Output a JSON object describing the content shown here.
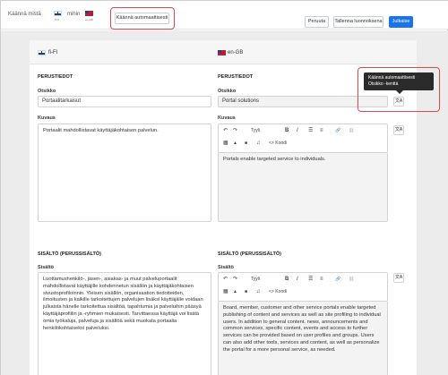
{
  "topbar": {
    "translate_from_label": "Käännä mistä",
    "from_flag_caption": "fi-FI",
    "translate_to_label": "mihin",
    "to_flag_caption": "en-GB",
    "auto_translate_button": "Käännä automaattisesti",
    "cancel_button": "Peruuta",
    "save_draft_button": "Tallenna luonnoksena",
    "publish_button": "Julkaise"
  },
  "languages": {
    "left": "fi-FI",
    "right": "en-GB"
  },
  "basic_info": {
    "section_title_left": "PERUSTIEDOT",
    "section_title_right": "PERUSTIEDOT",
    "title_label_left": "Otsikko",
    "title_value_left": "Portaalitarkaisut",
    "title_label_right": "Otsikko",
    "title_value_right": "Portal solutions",
    "desc_label_left": "Kuvaus",
    "desc_value_left": "Portaalit mahdollistavat käyttäjäkohtaisen palvelun.",
    "desc_label_right": "Kuvaus",
    "desc_value_right": "Portals enable targeted service to individuals."
  },
  "tooltip": {
    "text": "Käännä automaattisesti Otsikko -kenttä"
  },
  "toolbar": {
    "undo": "↶",
    "redo": "↷",
    "style_label": "Tyyli",
    "bold": "B",
    "italic": "I",
    "list_ul": "☰",
    "list_ol": "≡",
    "link": "🔗",
    "unlink": "⛓",
    "table": "▦",
    "image": "▲",
    "embed": "■",
    "audio": "♫",
    "code_label": "<> Koodi"
  },
  "content_section": {
    "section_title_left": "SISÄLTÖ (PERUSSISÄLTÖ)",
    "section_title_right": "SISÄLTÖ (PERUSSISÄLTÖ)",
    "label_left": "Sisältö",
    "label_right": "Sisältö",
    "value_left": "Luottamushenkilö-, jäsen-, asiakas- ja muut palveluportaalit mahdollistavat käyttäjille kohdennetun sisällön ja käyttäjäkohtaisen sivustoprofiloinnin. Yleisen sisällön, organisaation tiedotteiden, ilmoitusten ja kaikille tarkoitettujen palvelujen lisäksi käyttäjälle voidaan julkaista hänelle tarkoitettua sisältöä, tapahtumia ja palveluihin pääsyä käyttäjäprofiilin ja -ryhmien mukaisesti. Tarvittaessa käyttäjä voi lisätä omia työkaluja, palveluja ja sisältöä sekä muokata portaalia henkilökohtaiseksi palveluksi.",
    "value_right": "Board, member, customer and other service portals enable targeted publishing of content and services as well as site profiling to individual users. In addition to general content, news, announcements and common services, specific content, events and access to further services can be provided based on user profiles and groups. Users can also add other tools, services and content, as well as personalize the portal for a more personal service, as needed."
  },
  "colors": {
    "primary": "#1a73e8",
    "highlight": "#e0474c",
    "tooltip_bg": "#2b2b2b"
  }
}
